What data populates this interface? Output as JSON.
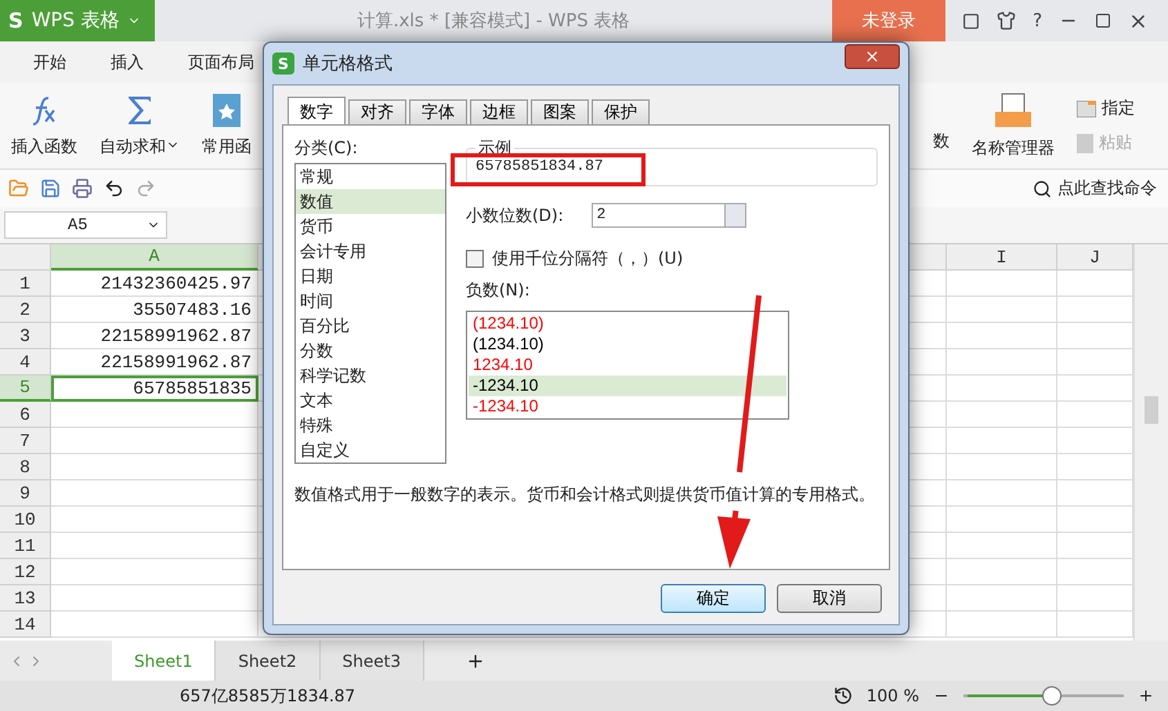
{
  "app": {
    "logo": "S",
    "name": "WPS 表格",
    "title": "计算.xls * [兼容模式] - WPS 表格",
    "login": "未登录",
    "help": "?"
  },
  "menu_tabs": [
    "开始",
    "插入",
    "页面布局"
  ],
  "ribbon_left": [
    {
      "label": "插入函数",
      "kind": "fx",
      "dropdown": false
    },
    {
      "label": "自动求和",
      "kind": "sigma",
      "dropdown": true
    },
    {
      "label": "常用函",
      "kind": "star",
      "dropdown": false
    }
  ],
  "ribbon_right": {
    "partial": "数",
    "manager": "名称管理器",
    "assign": "指定",
    "paste": {
      "label": "粘贴",
      "disabled": true
    }
  },
  "search_command": "点此查找命令",
  "name_box": "A5",
  "columns": [
    "A",
    "I",
    "J"
  ],
  "rows": [
    {
      "num": "1",
      "value": "21432360425.97",
      "selected": false
    },
    {
      "num": "2",
      "value": "35507483.16",
      "selected": false
    },
    {
      "num": "3",
      "value": "22158991962.87",
      "selected": false
    },
    {
      "num": "4",
      "value": "22158991962.87",
      "selected": false
    },
    {
      "num": "5",
      "value": "65785851835",
      "selected": true
    },
    {
      "num": "6",
      "selected": false
    },
    {
      "num": "7",
      "selected": false
    },
    {
      "num": "8",
      "selected": false
    },
    {
      "num": "9",
      "selected": false
    },
    {
      "num": "10",
      "selected": false
    },
    {
      "num": "11",
      "selected": false
    },
    {
      "num": "12",
      "selected": false
    },
    {
      "num": "13",
      "selected": false
    },
    {
      "num": "14",
      "selected": false
    }
  ],
  "sheets": [
    {
      "label": "Sheet1",
      "selected": true
    },
    {
      "label": "Sheet2",
      "selected": false
    },
    {
      "label": "Sheet3",
      "selected": false
    }
  ],
  "status": {
    "sum": "657亿8585万1834.87",
    "zoom": "100 %",
    "level": 0.55
  },
  "dialog": {
    "logo": "S",
    "title": "单元格格式",
    "tabs": [
      {
        "label": "数字",
        "selected": true
      },
      {
        "label": "对齐",
        "selected": false
      },
      {
        "label": "字体",
        "selected": false
      },
      {
        "label": "边框",
        "selected": false
      },
      {
        "label": "图案",
        "selected": false
      },
      {
        "label": "保护",
        "selected": false
      }
    ],
    "category_label": "分类(C):",
    "categories": [
      {
        "label": "常规",
        "selected": false
      },
      {
        "label": "数值",
        "selected": true
      },
      {
        "label": "货币",
        "selected": false
      },
      {
        "label": "会计专用",
        "selected": false
      },
      {
        "label": "日期",
        "selected": false
      },
      {
        "label": "时间",
        "selected": false
      },
      {
        "label": "百分比",
        "selected": false
      },
      {
        "label": "分数",
        "selected": false
      },
      {
        "label": "科学记数",
        "selected": false
      },
      {
        "label": "文本",
        "selected": false
      },
      {
        "label": "特殊",
        "selected": false
      },
      {
        "label": "自定义",
        "selected": false
      }
    ],
    "sample_label": "示例",
    "sample": "65785851834.87",
    "decimals_label": "小数位数(D):",
    "decimals": "2",
    "separator": {
      "label": "使用千位分隔符（，）(U)",
      "checked": false
    },
    "negative_label": "负数(N):",
    "negatives": [
      {
        "text": "(1234.10)",
        "color": "#ff0000",
        "selected": false
      },
      {
        "text": "(1234.10)",
        "color": "#000000",
        "selected": false
      },
      {
        "text": "1234.10",
        "color": "#ff0000",
        "selected": false
      },
      {
        "text": "-1234.10",
        "color": "#000000",
        "selected": true
      },
      {
        "text": "-1234.10",
        "color": "#ff0000",
        "selected": false
      }
    ],
    "description": "数值格式用于一般数字的表示。货币和会计格式则提供货币值计算的专用格式。",
    "buttons": [
      {
        "label": "确定",
        "kind": "primary"
      },
      {
        "label": "取消",
        "kind": "normal"
      }
    ]
  },
  "annotations": {
    "highlight_box": true,
    "arrow": true
  }
}
